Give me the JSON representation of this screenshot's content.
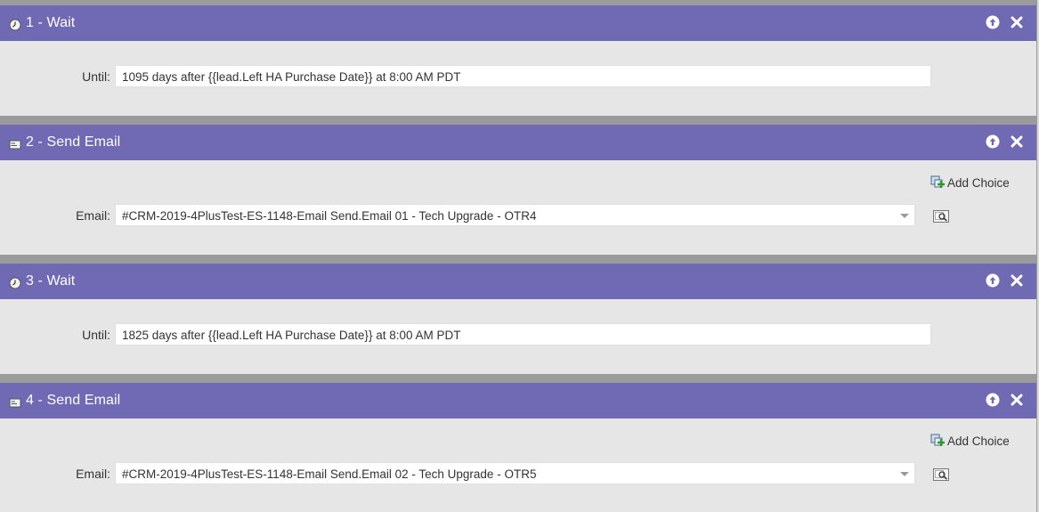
{
  "steps": [
    {
      "title": "1 - Wait",
      "icon": "clock-icon",
      "field_label": "Until:",
      "field_value": "1095 days after {{lead.Left HA Purchase Date}} at 8:00 AM PDT"
    },
    {
      "title": "2 - Send Email",
      "icon": "email-icon",
      "field_label": "Email:",
      "field_value": "#CRM-2019-4PlusTest-ES-1148-Email Send.Email 01 - Tech Upgrade - OTR4",
      "add_choice": "Add Choice"
    },
    {
      "title": "3 - Wait",
      "icon": "clock-icon",
      "field_label": "Until:",
      "field_value": "1825 days after {{lead.Left HA Purchase Date}} at 8:00 AM PDT"
    },
    {
      "title": "4 - Send Email",
      "icon": "email-icon",
      "field_label": "Email:",
      "field_value": "#CRM-2019-4PlusTest-ES-1148-Email Send.Email 02 - Tech Upgrade - OTR5",
      "add_choice": "Add Choice"
    }
  ],
  "colors": {
    "header": "#7069b3",
    "body": "#e6e6e6",
    "separator": "#9b9b9b"
  }
}
